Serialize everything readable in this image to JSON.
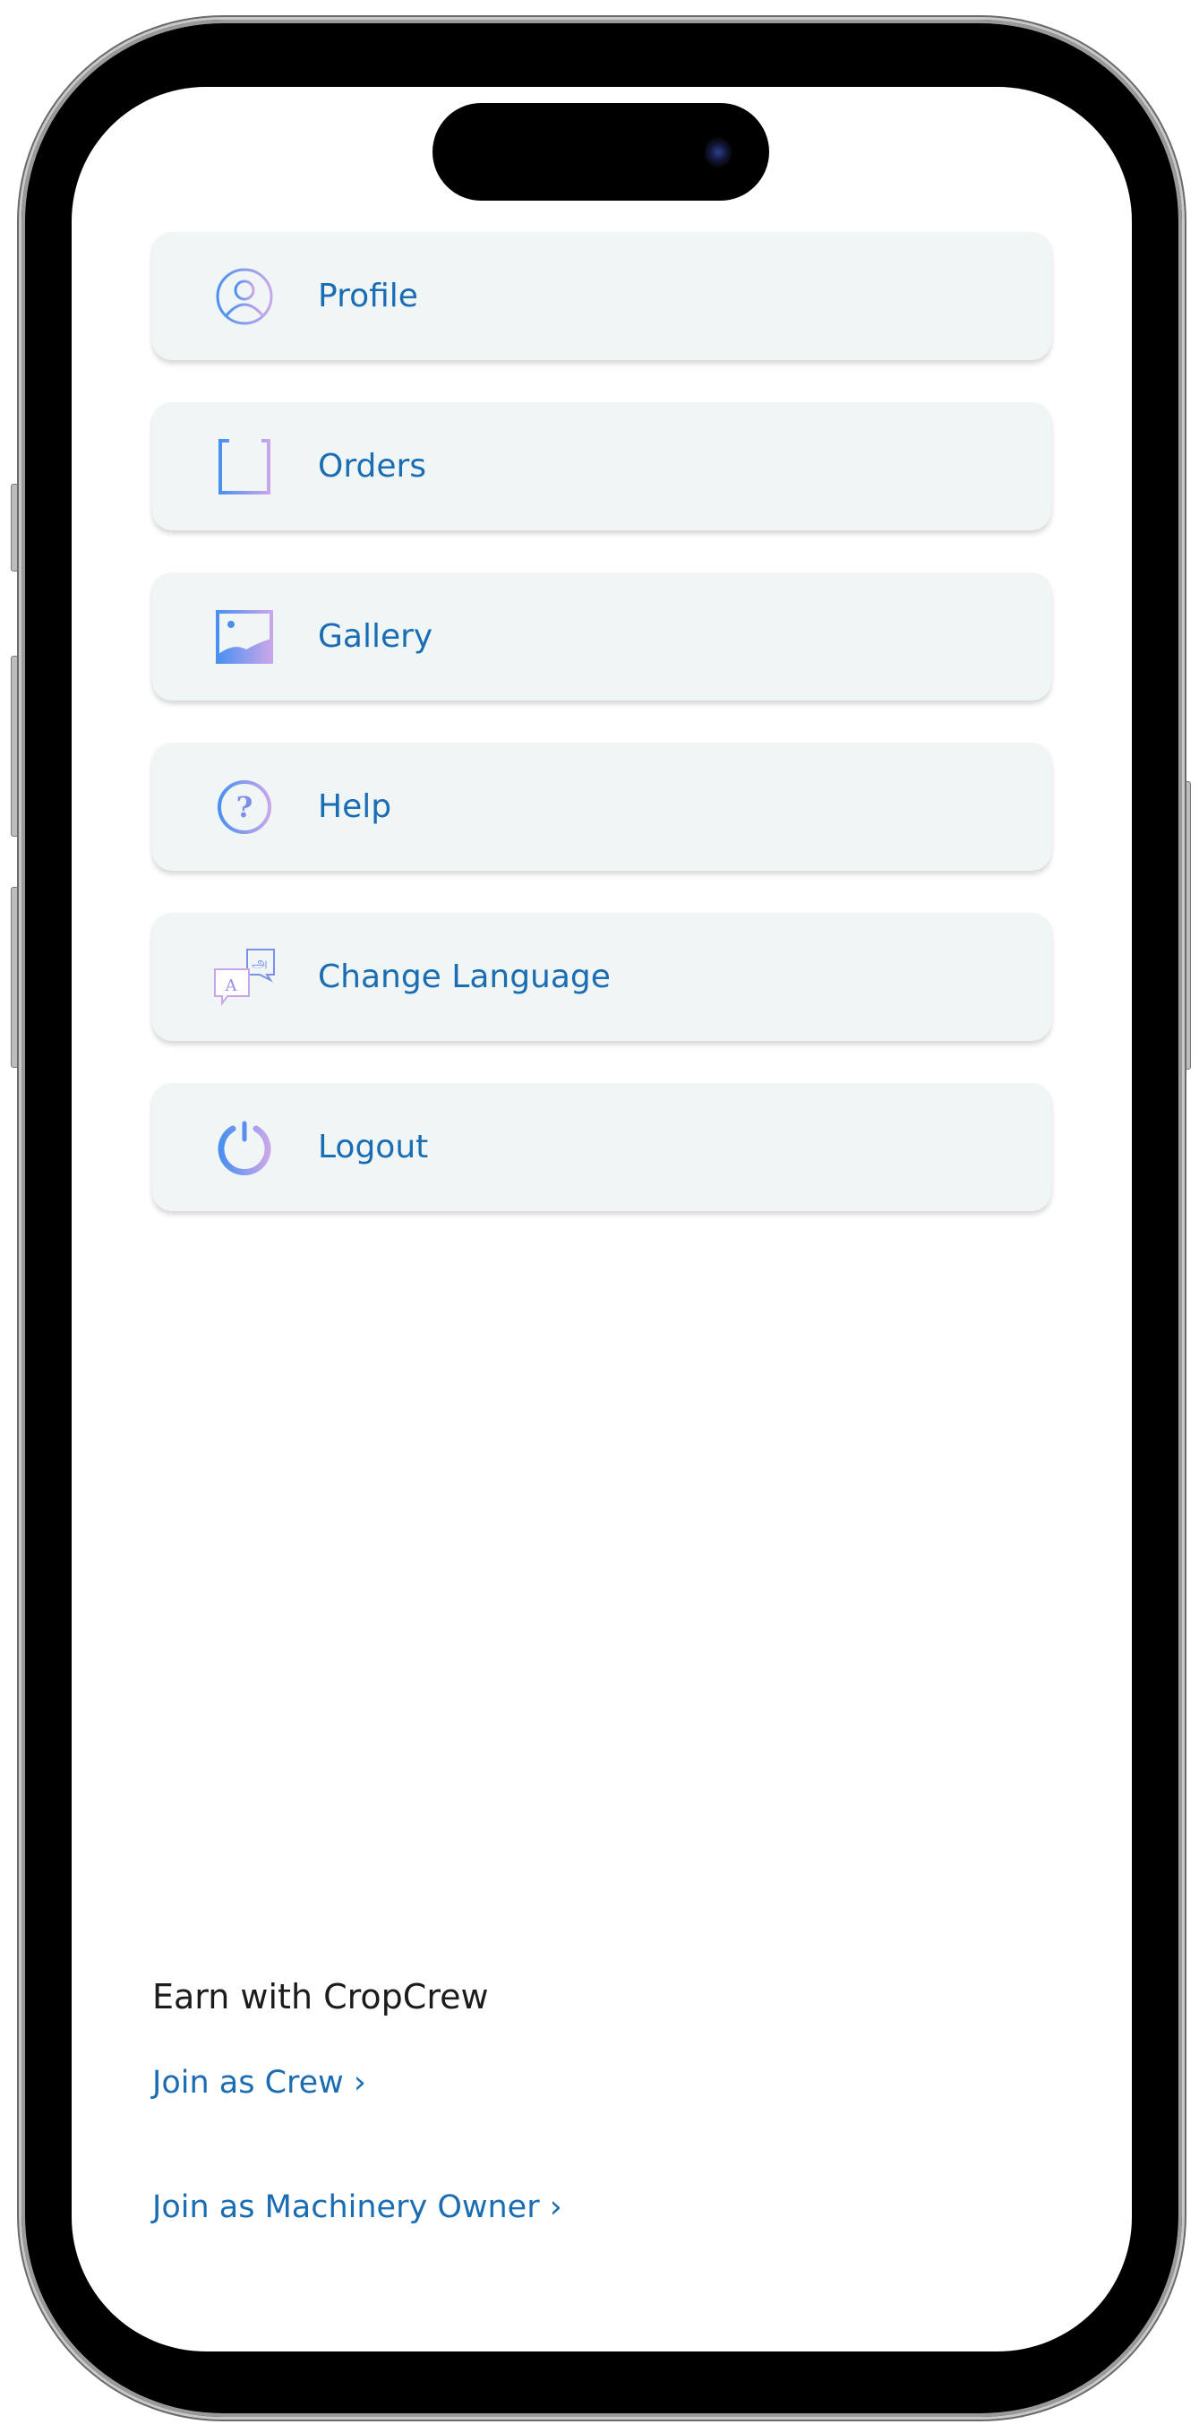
{
  "menu": [
    {
      "label": "Profile",
      "icon": "profile-icon"
    },
    {
      "label": "Orders",
      "icon": "orders-icon"
    },
    {
      "label": "Gallery",
      "icon": "gallery-icon"
    },
    {
      "label": "Help",
      "icon": "help-icon"
    },
    {
      "label": "Change Language",
      "icon": "language-icon"
    },
    {
      "label": "Logout",
      "icon": "power-icon"
    }
  ],
  "earn": {
    "title": "Earn with CropCrew",
    "join_crew": "Join as Crew ›",
    "join_owner": "Join as Machinery Owner ›"
  },
  "colors": {
    "accent": "#1a6db3",
    "card_bg": "#f0f5f5",
    "icon_gradient_start": "#4a90f0",
    "icon_gradient_end": "#c9a6ea"
  }
}
